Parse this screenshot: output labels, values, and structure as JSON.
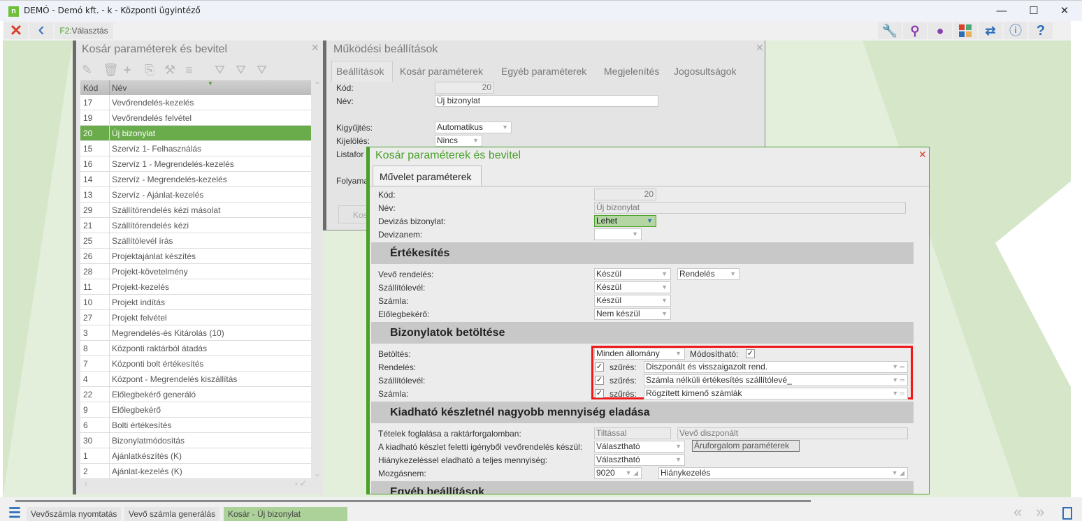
{
  "window": {
    "app_icon": "n",
    "title": "DEMÓ - Demó kft. - k - Központi ügyintéző",
    "minimize": "—",
    "maximize": "☐",
    "close": "✕"
  },
  "toolbar": {
    "close_icon": "✕",
    "back_icon": "‹",
    "f2_key": "F2:",
    "f2_label": "Választás",
    "right_icons": [
      "wrench-icon",
      "search-icon",
      "user-icon",
      "tiles-icon",
      "swap-icon",
      "info-icon",
      "help-icon"
    ]
  },
  "list_panel": {
    "title": "Kosár paraméterek és bevitel",
    "columns": [
      "Kód",
      "Név"
    ],
    "rows": [
      [
        "17",
        "Vevőrendelés-kezelés"
      ],
      [
        "19",
        "Vevőrendelés felvétel"
      ],
      [
        "20",
        "Új bizonylat"
      ],
      [
        "15",
        "Szervíz 1- Felhasználás"
      ],
      [
        "16",
        "Szervíz 1 - Megrendelés-kezelés"
      ],
      [
        "14",
        "Szervíz - Megrendelés-kezelés"
      ],
      [
        "13",
        "Szervíz - Ajánlat-kezelés"
      ],
      [
        "29",
        "Szállítórendelés kézi másolat"
      ],
      [
        "21",
        "Szállítórendelés kézi"
      ],
      [
        "25",
        "Szállítólevél írás"
      ],
      [
        "26",
        "Projektajánlat készítés"
      ],
      [
        "28",
        "Projekt-követelmény"
      ],
      [
        "11",
        "Projekt-kezelés"
      ],
      [
        "10",
        "Projekt indítás"
      ],
      [
        "27",
        "Projekt felvétel"
      ],
      [
        "3",
        "Megrendelés-és Kitárolás (10)"
      ],
      [
        "8",
        "Központi raktárból átadás"
      ],
      [
        "7",
        "Központi bolt értékesítés"
      ],
      [
        "4",
        "Központ - Megrendelés kiszállítás"
      ],
      [
        "22",
        "Előlegbekérő generáló"
      ],
      [
        "9",
        "Előlegbekérő"
      ],
      [
        "6",
        "Bolti értékesítés"
      ],
      [
        "30",
        "Bizonylatmódosítás"
      ],
      [
        "1",
        "Ajánlatkészítés (K)"
      ],
      [
        "2",
        "Ajánlat-kezelés (K)"
      ]
    ],
    "selected_code": "20"
  },
  "mid_panel": {
    "title": "Működési beállítások",
    "tabs": [
      "Beállítások",
      "Kosár paraméterek",
      "Egyéb paraméterek",
      "Megjelenítés",
      "Jogosultságok"
    ],
    "kod_label": "Kód:",
    "kod": "20",
    "nev_label": "Név:",
    "nev": "Új bizonylat",
    "kigyujtes_label": "Kigyűjtés:",
    "kigyujtes": "Automatikus",
    "kijeloles_label": "Kijelölés:",
    "kijeloles": "Nincs",
    "listafor_label": "Listafor",
    "folyama_label": "Folyama",
    "kos_button": "Kos"
  },
  "dialog": {
    "title": "Kosár paraméterek és bevitel",
    "tab": "Művelet paraméterek",
    "kod_label": "Kód:",
    "kod": "20",
    "nev_label": "Név:",
    "nev": "Új bizonylat",
    "deviza_label": "Devizás bizonylat:",
    "deviza": "Lehet",
    "devizanem_label": "Devizanem:",
    "devizanem": "",
    "sec1": "Értékesítés",
    "vevo_rendeles_label": "Vevő rendelés:",
    "vevo_rendeles": "Készül",
    "vevo_rendeles2": "Rendelés",
    "szallitolevel_label": "Szállítólevél:",
    "szallitolevel": "Készül",
    "szamla_label": "Számla:",
    "szamla": "Készül",
    "eloleg_label": "Előlegbekérő:",
    "eloleg": "Nem készül",
    "sec2": "Bizonylatok betöltése",
    "betoltes_label": "Betöltés:",
    "betoltes": "Minden állomány",
    "modosithato_label": "Módosítható:",
    "szures": "szűrés:",
    "rendeles_label": "Rendelés:",
    "rendeles_filter": "Diszponált és visszaigazolt rend.",
    "szall_filter": "Számla nélküli értékesítés szállítólevé_",
    "szamla_filter": "Rögzített kimenő számlák",
    "check": "✓",
    "sec3": "Kiadható készletnél nagyobb mennyiség eladása",
    "tetelek_label": "Tételek foglalása a raktárforgalomban:",
    "tetelek": "Tiltással",
    "tetelek2": "Vevő diszponált",
    "kiadhato_label": "A kiadható készlet feletti igényből vevőrendelés készül:",
    "kiadhato": "Választható",
    "aruforgalom_button": "Áruforgalom paraméterek",
    "hiany_label": "Hiánykezeléssel eladható a teljes mennyiség:",
    "hiany": "Választható",
    "mozgas_label": "Mozgásnem:",
    "mozgas_code": "9020",
    "mozgas_name": "Hiánykezelés",
    "sec4": "Egyéb beállítások"
  },
  "bottom": {
    "tabs": [
      "Vevőszámla nyomtatás",
      "Vevő számla generálás",
      "Kosár - Új bizonylat"
    ],
    "active": "Kosár - Új bizonylat"
  }
}
